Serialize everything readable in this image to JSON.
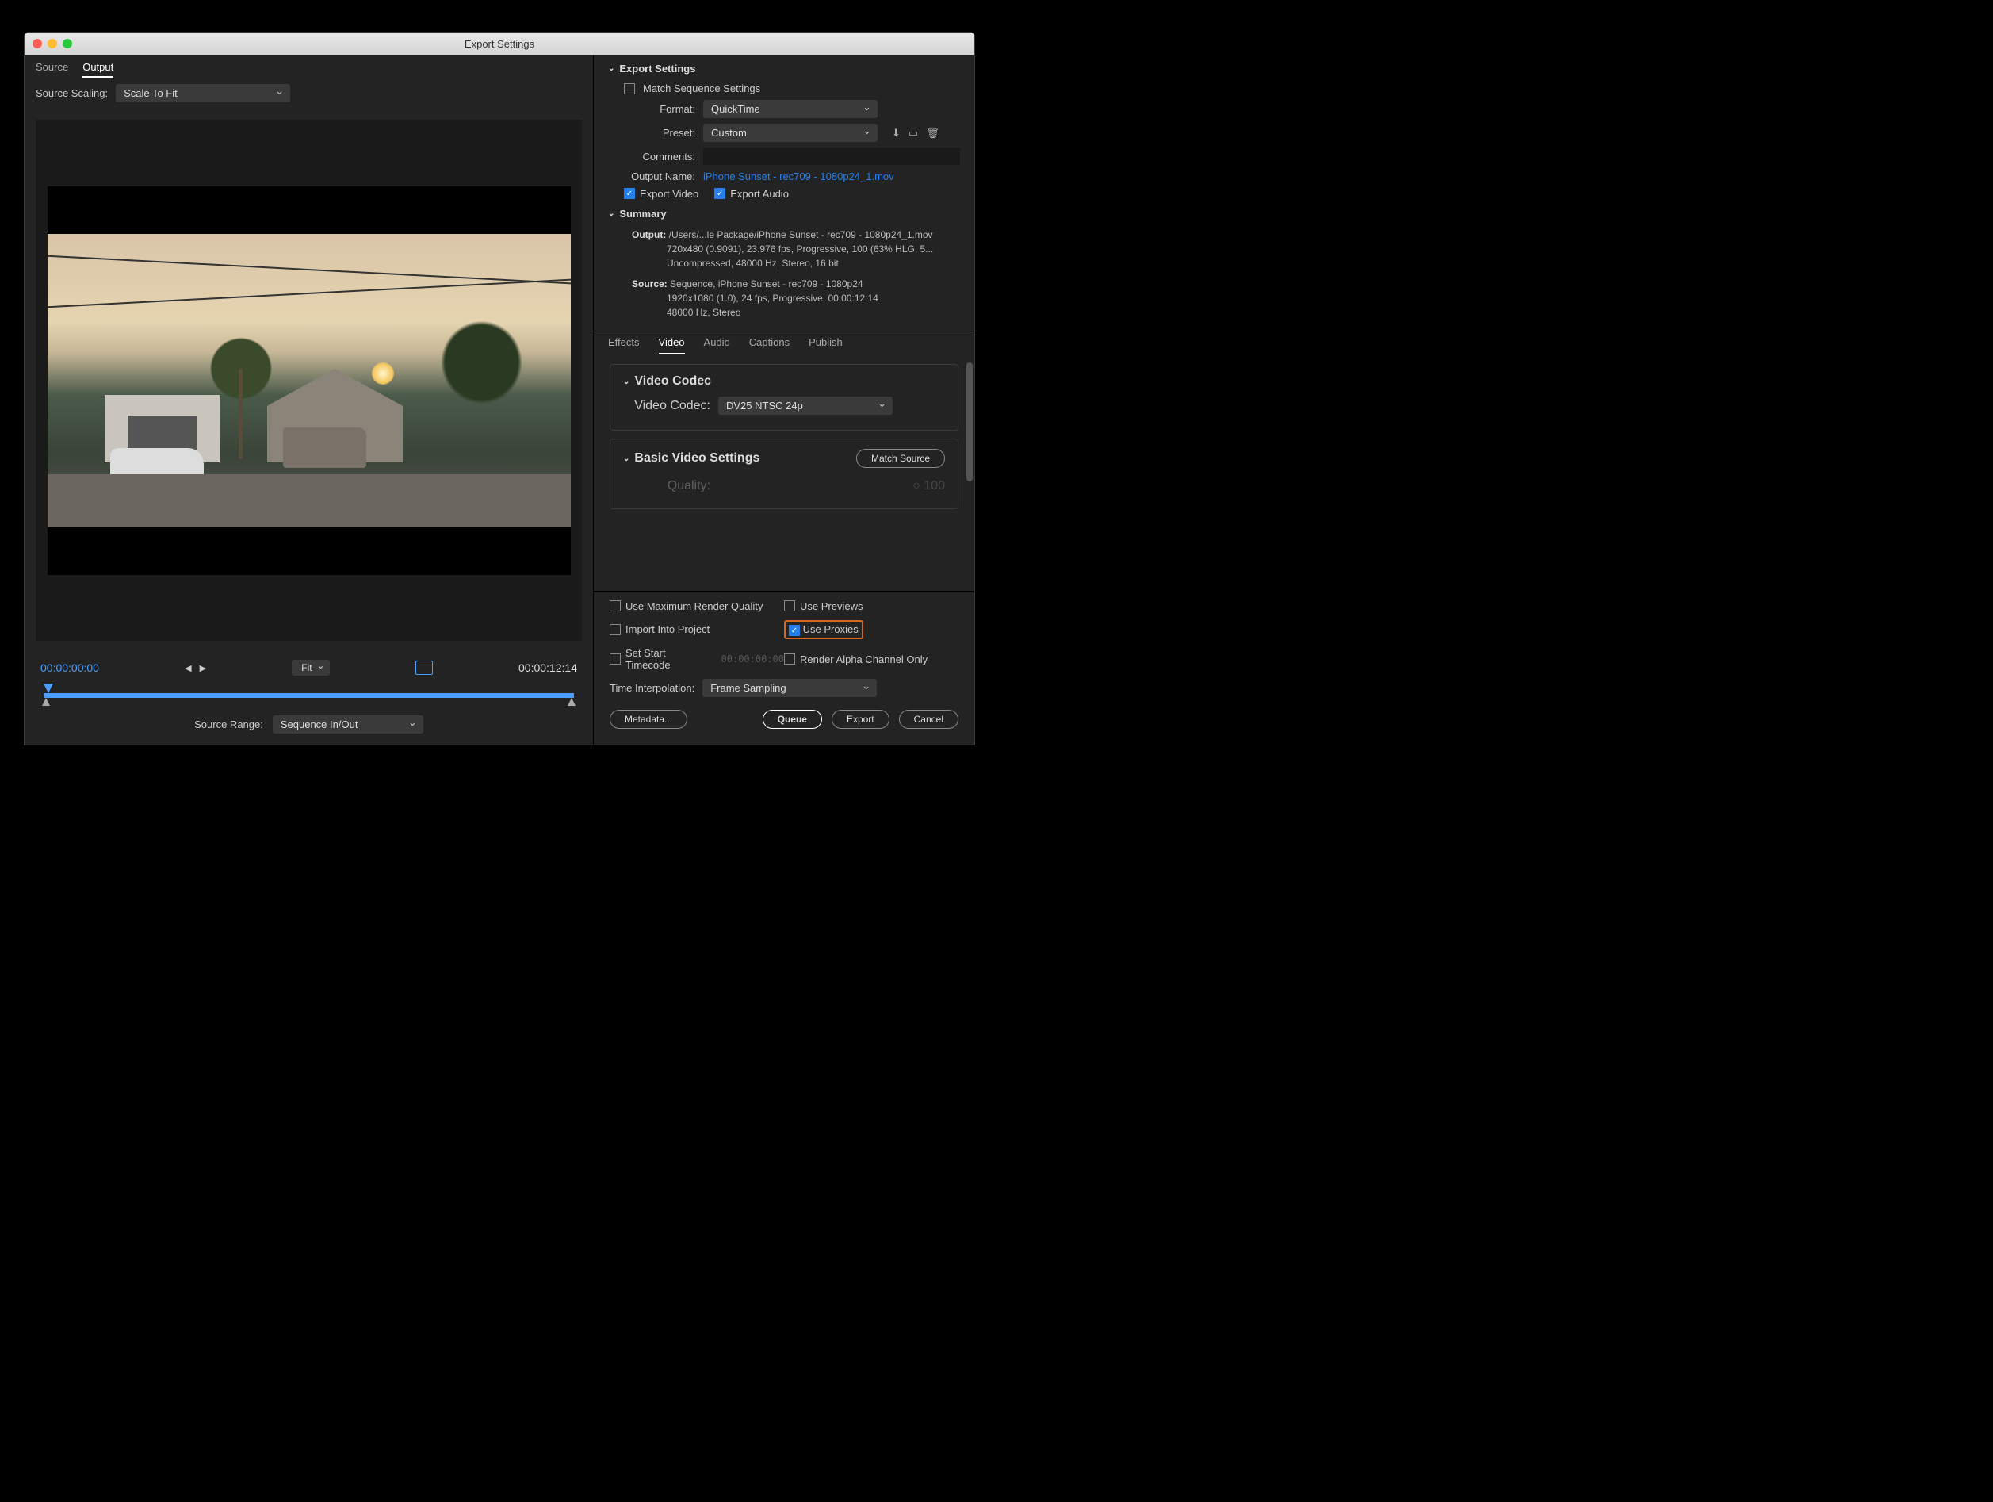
{
  "window": {
    "title": "Export Settings"
  },
  "left": {
    "tabs": {
      "source": "Source",
      "output": "Output"
    },
    "scaling_label": "Source Scaling:",
    "scaling_value": "Scale To Fit",
    "time_left": "00:00:00:00",
    "time_right": "00:00:12:14",
    "zoom": "Fit",
    "source_range_label": "Source Range:",
    "source_range_value": "Sequence In/Out"
  },
  "export": {
    "title": "Export Settings",
    "match_seq": "Match Sequence Settings",
    "format_label": "Format:",
    "format_value": "QuickTime",
    "preset_label": "Preset:",
    "preset_value": "Custom",
    "comments_label": "Comments:",
    "output_name_label": "Output Name:",
    "output_name_value": "iPhone Sunset - rec709 - 1080p24_1.mov",
    "export_video": "Export Video",
    "export_audio": "Export Audio",
    "summary_title": "Summary",
    "summary_output_label": "Output:",
    "summary_output_1": "/Users/...le Package/iPhone Sunset - rec709 - 1080p24_1.mov",
    "summary_output_2": "720x480 (0.9091), 23.976 fps, Progressive, 100 (63% HLG, 5...",
    "summary_output_3": "Uncompressed, 48000 Hz, Stereo, 16 bit",
    "summary_source_label": "Source:",
    "summary_source_1": "Sequence, iPhone Sunset - rec709 - 1080p24",
    "summary_source_2": "1920x1080 (1.0), 24 fps, Progressive, 00:00:12:14",
    "summary_source_3": "48000 Hz, Stereo"
  },
  "settings_tabs": {
    "effects": "Effects",
    "video": "Video",
    "audio": "Audio",
    "captions": "Captions",
    "publish": "Publish"
  },
  "video_panel": {
    "codec_title": "Video Codec",
    "codec_label": "Video Codec:",
    "codec_value": "DV25 NTSC 24p",
    "basic_title": "Basic Video Settings",
    "match_source": "Match Source",
    "quality_label": "Quality:",
    "quality_value": "100"
  },
  "bottom": {
    "max_quality": "Use Maximum Render Quality",
    "previews": "Use Previews",
    "import": "Import Into Project",
    "proxies": "Use Proxies",
    "set_tc": "Set Start Timecode",
    "tc_value": "00:00:00:00",
    "render_alpha": "Render Alpha Channel Only",
    "ti_label": "Time Interpolation:",
    "ti_value": "Frame Sampling"
  },
  "buttons": {
    "metadata": "Metadata...",
    "queue": "Queue",
    "export": "Export",
    "cancel": "Cancel"
  }
}
